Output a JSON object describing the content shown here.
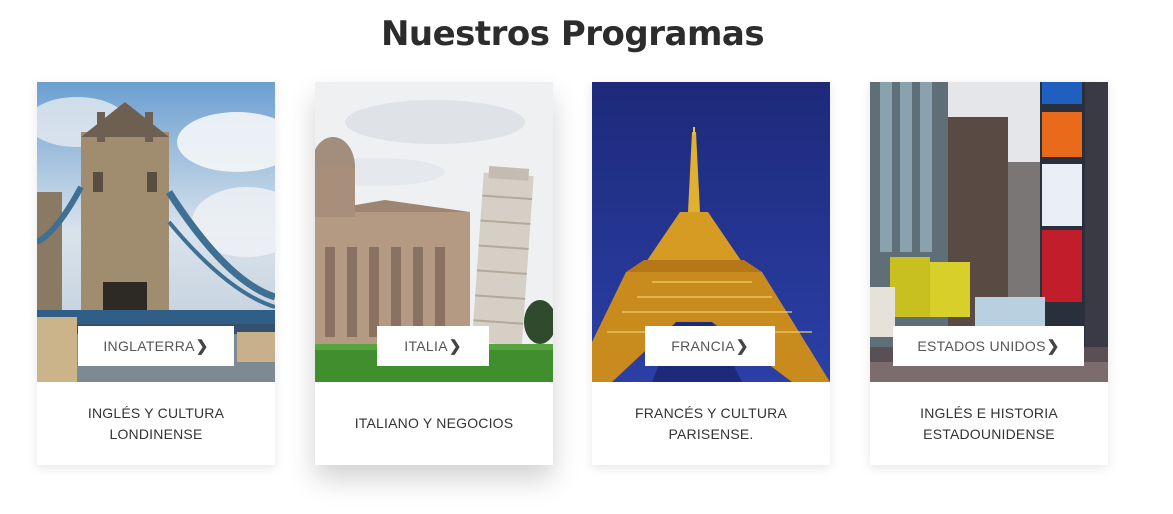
{
  "heading": "Nuestros Programas",
  "programs": [
    {
      "button_label": "INGLATERRA",
      "caption": "INGLÉS Y CULTURA LONDINENSE",
      "image": "tower-bridge-icon"
    },
    {
      "button_label": "ITALIA",
      "caption": "ITALIANO Y NEGOCIOS",
      "image": "pisa-tower-icon"
    },
    {
      "button_label": "FRANCIA",
      "caption": "FRANCÉS Y CULTURA PARISENSE.",
      "image": "eiffel-tower-icon"
    },
    {
      "button_label": "ESTADOS UNIDOS",
      "caption": "INGLÉS E HISTORIA ESTADOUNIDENSE",
      "image": "times-square-icon"
    }
  ],
  "chevron_icon": "chevron-right-icon"
}
